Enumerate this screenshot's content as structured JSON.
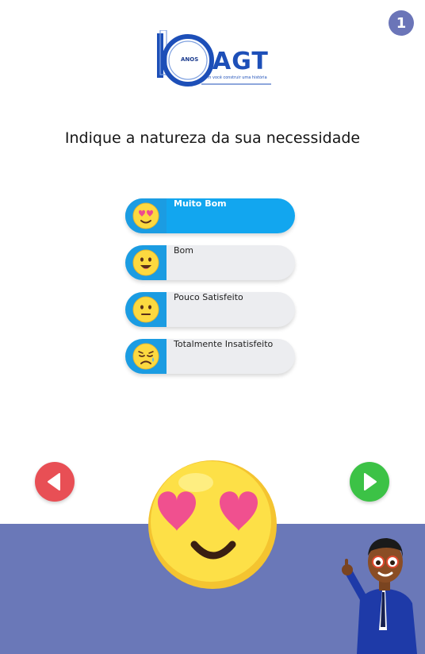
{
  "step_badge": "1",
  "logo": {
    "anos": "ANOS",
    "brand": "AGT",
    "tagline": "Com você construir uma história"
  },
  "question": "Indique a natureza da sua necessidade",
  "options": [
    {
      "label": "Muito Bom",
      "icon": "heart-eyes-emoji-icon",
      "selected": true
    },
    {
      "label": "Bom",
      "icon": "smiling-face-emoji-icon",
      "selected": false
    },
    {
      "label": "Pouco Satisfeito",
      "icon": "neutral-face-emoji-icon",
      "selected": false
    },
    {
      "label": "Totalmente Insatisfeito",
      "icon": "sad-face-emoji-icon",
      "selected": false
    }
  ],
  "navigation": {
    "prev_icon": "play-left-icon",
    "next_icon": "play-right-icon"
  },
  "colors": {
    "accent_blue": "#12a6ef",
    "bottom_band": "#6a78b8",
    "prev_red": "#e84f55",
    "next_green": "#3cc246",
    "badge": "#6b75b8"
  }
}
